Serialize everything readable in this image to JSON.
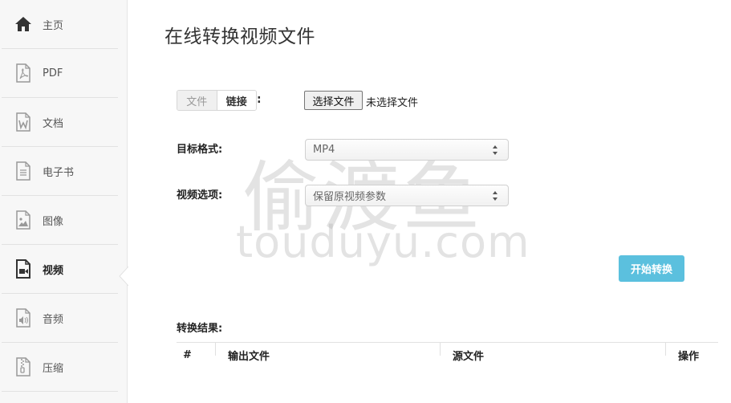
{
  "sidebar": {
    "items": [
      {
        "label": "主页",
        "icon": "home-icon"
      },
      {
        "label": "PDF",
        "icon": "pdf-file-icon"
      },
      {
        "label": "文档",
        "icon": "word-file-icon"
      },
      {
        "label": "电子书",
        "icon": "ebook-file-icon"
      },
      {
        "label": "图像",
        "icon": "image-file-icon"
      },
      {
        "label": "视频",
        "icon": "video-file-icon",
        "active": true
      },
      {
        "label": "音频",
        "icon": "audio-file-icon"
      },
      {
        "label": "压缩",
        "icon": "archive-file-icon"
      }
    ]
  },
  "main": {
    "title": "在线转换视频文件",
    "source_toggle": {
      "file_label": "文件",
      "link_label": "链接",
      "colon": ":"
    },
    "file_input": {
      "button_label": "选择文件",
      "status": "未选择文件"
    },
    "target_format": {
      "label": "目标格式:",
      "value": "MP4"
    },
    "video_options": {
      "label": "视频选项:",
      "value": "保留原视频参数"
    },
    "start_button": "开始转换",
    "results": {
      "label": "转换结果:",
      "columns": [
        "#",
        "输出文件",
        "源文件",
        "操作"
      ]
    }
  },
  "watermark": {
    "cn": "偷渡鱼",
    "en": "touduyu.com"
  },
  "colors": {
    "accent": "#5bc0de",
    "sidebar_bg": "#f7f7f7",
    "icon": "#888888",
    "icon_active": "#333333"
  }
}
